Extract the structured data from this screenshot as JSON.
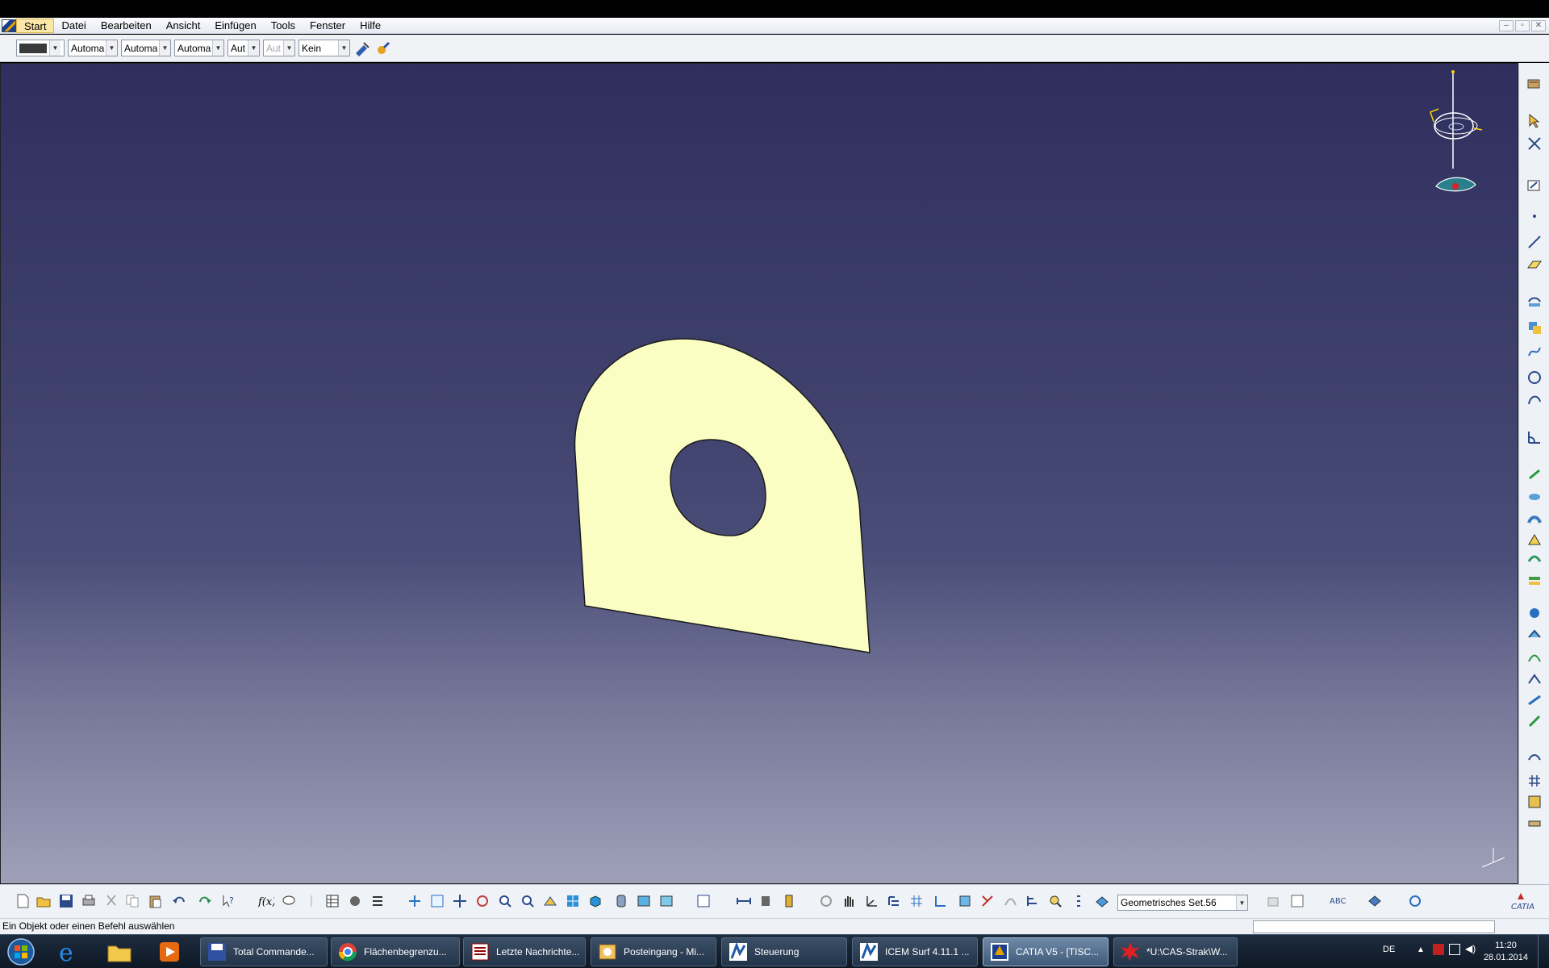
{
  "menubar": {
    "items": [
      {
        "label": "Start"
      },
      {
        "label": "Datei"
      },
      {
        "label": "Bearbeiten"
      },
      {
        "label": "Ansicht"
      },
      {
        "label": "Einfügen"
      },
      {
        "label": "Tools"
      },
      {
        "label": "Fenster"
      },
      {
        "label": "Hilfe"
      }
    ],
    "window_controls": [
      "–",
      "▫",
      "✕"
    ]
  },
  "properties_toolbar": {
    "color_value": "#3a3a3a",
    "linetype": "Automa",
    "thickness": "Automa",
    "rendering": "Automa",
    "layer": "Aut",
    "layer_disabled": "Aut",
    "filter": "Kein"
  },
  "viewport": {
    "background_top": "#2f2f5e",
    "background_bottom": "#9fa0b8",
    "part_fill": "#fbfec3",
    "part_stroke": "#1a1a1a"
  },
  "bottom_toolbar": {
    "geometric_set": "Geometrisches Set.56"
  },
  "statusbar": {
    "message": "Ein Objekt oder einen Befehl auswählen"
  },
  "taskbar": {
    "buttons": [
      {
        "label": "Total Commande...",
        "icon": "floppy-icon"
      },
      {
        "label": "Flächenbegrenzu...",
        "icon": "chrome-icon"
      },
      {
        "label": "Letzte Nachrichte...",
        "icon": "news-icon"
      },
      {
        "label": "Posteingang - Mi...",
        "icon": "outlook-icon"
      },
      {
        "label": "Steuerung",
        "icon": "icem-icon"
      },
      {
        "label": "ICEM Surf 4.11.1 ...",
        "icon": "icem-icon"
      },
      {
        "label": "CATIA V5 - [TISC...",
        "icon": "catia-icon"
      },
      {
        "label": "*U:\\CAS-Strak\\W...",
        "icon": "splat-icon"
      }
    ],
    "language": "DE",
    "time": "11:20",
    "date": "28.01.2014"
  }
}
